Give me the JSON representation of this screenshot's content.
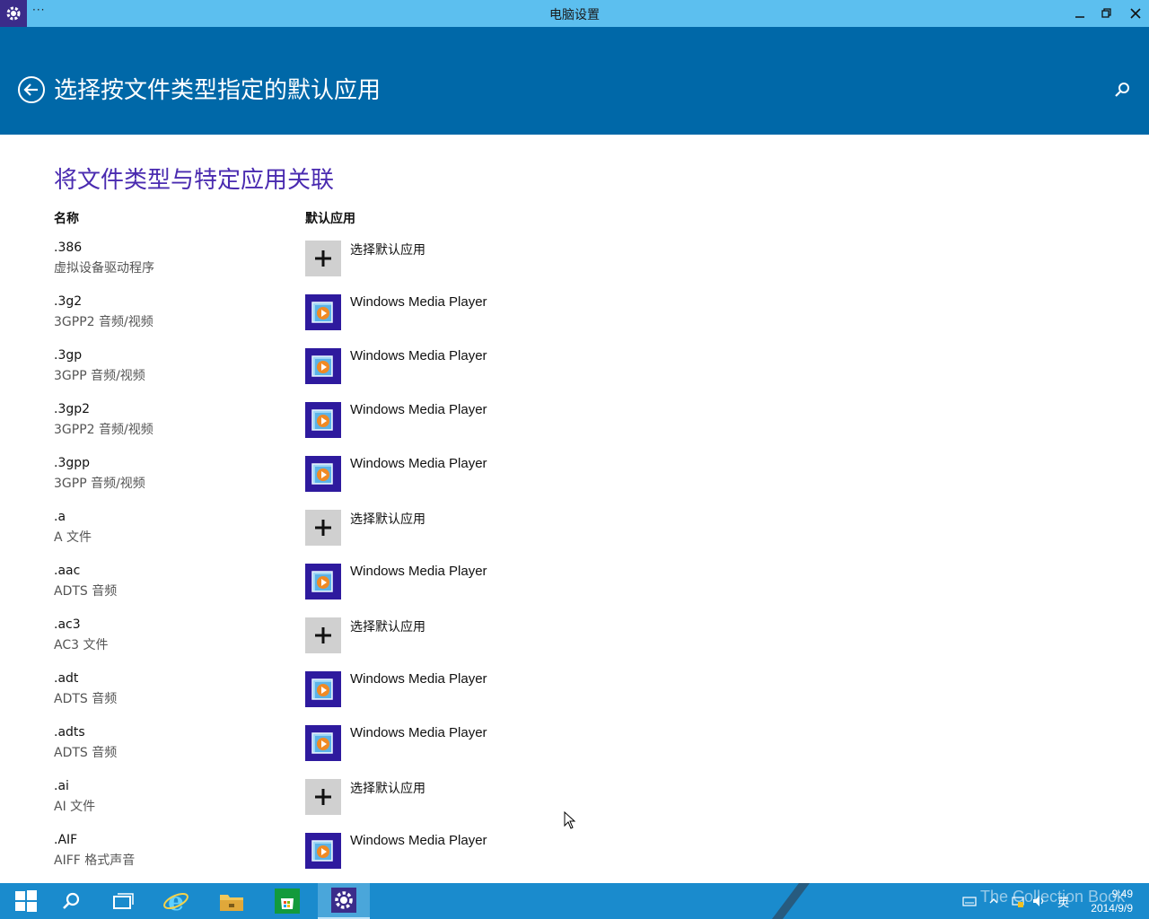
{
  "window": {
    "title": "电脑设置",
    "menu_dots": "···"
  },
  "header": {
    "heading": "选择按文件类型指定的默认应用"
  },
  "main": {
    "section_title": "将文件类型与特定应用关联",
    "col_name": "名称",
    "col_default_app": "默认应用",
    "rows": [
      {
        "ext": ".386",
        "desc": "虚拟设备驱动程序",
        "app": "选择默认应用",
        "icon": "plus-icon"
      },
      {
        "ext": ".3g2",
        "desc": "3GPP2 音频/视频",
        "app": "Windows Media Player",
        "icon": "windows-media-player-icon"
      },
      {
        "ext": ".3gp",
        "desc": "3GPP 音频/视频",
        "app": "Windows Media Player",
        "icon": "windows-media-player-icon"
      },
      {
        "ext": ".3gp2",
        "desc": "3GPP2 音频/视频",
        "app": "Windows Media Player",
        "icon": "windows-media-player-icon"
      },
      {
        "ext": ".3gpp",
        "desc": "3GPP 音频/视频",
        "app": "Windows Media Player",
        "icon": "windows-media-player-icon"
      },
      {
        "ext": ".a",
        "desc": "A 文件",
        "app": "选择默认应用",
        "icon": "plus-icon"
      },
      {
        "ext": ".aac",
        "desc": "ADTS 音频",
        "app": "Windows Media Player",
        "icon": "windows-media-player-icon"
      },
      {
        "ext": ".ac3",
        "desc": "AC3 文件",
        "app": "选择默认应用",
        "icon": "plus-icon"
      },
      {
        "ext": ".adt",
        "desc": "ADTS 音频",
        "app": "Windows Media Player",
        "icon": "windows-media-player-icon"
      },
      {
        "ext": ".adts",
        "desc": "ADTS 音频",
        "app": "Windows Media Player",
        "icon": "windows-media-player-icon"
      },
      {
        "ext": ".ai",
        "desc": "AI 文件",
        "app": "选择默认应用",
        "icon": "plus-icon"
      },
      {
        "ext": ".AIF",
        "desc": "AIFF 格式声音",
        "app": "Windows Media Player",
        "icon": "windows-media-player-icon"
      }
    ]
  },
  "taskbar": {
    "clock_time": "9:49",
    "clock_date": "2014/9/9",
    "ime": "英",
    "watermark": "The Collection Book"
  },
  "colors": {
    "titlebar": "#5cbfef",
    "header": "#0068a8",
    "accent_title": "#4a2bb0",
    "taskbar": "#1a8bcd"
  }
}
